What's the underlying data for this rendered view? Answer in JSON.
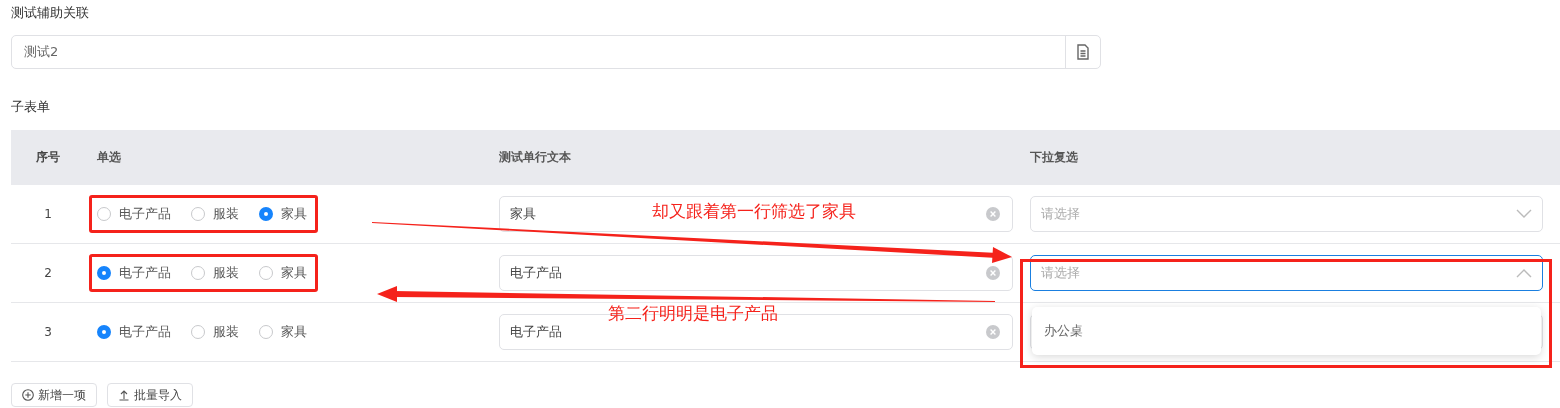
{
  "field": {
    "label": "测试辅助关联",
    "value": "测试2"
  },
  "subform": {
    "title": "子表单",
    "columns": [
      "序号",
      "单选",
      "测试单行文本",
      "下拉复选"
    ],
    "rows": [
      {
        "index": "1",
        "radio_highlighted": true,
        "options": [
          {
            "label": "电子产品",
            "selected": false
          },
          {
            "label": "服装",
            "selected": false
          },
          {
            "label": "家具",
            "selected": true
          }
        ],
        "text": "家具",
        "select": {
          "placeholder": "请选择",
          "expanded": false,
          "highlighted": false
        }
      },
      {
        "index": "2",
        "radio_highlighted": true,
        "options": [
          {
            "label": "电子产品",
            "selected": true
          },
          {
            "label": "服装",
            "selected": false
          },
          {
            "label": "家具",
            "selected": false
          }
        ],
        "text": "电子产品",
        "select": {
          "placeholder": "请选择",
          "expanded": true,
          "highlighted": true,
          "options": [
            "办公桌"
          ]
        }
      },
      {
        "index": "3",
        "radio_highlighted": false,
        "options": [
          {
            "label": "电子产品",
            "selected": true
          },
          {
            "label": "服装",
            "selected": false
          },
          {
            "label": "家具",
            "selected": false
          }
        ],
        "text": "电子产品",
        "select": {
          "expanded": false,
          "highlighted": false
        }
      }
    ],
    "buttons": [
      {
        "kind": "add",
        "label": "新增一项"
      },
      {
        "kind": "import",
        "label": "批量导入"
      }
    ]
  },
  "annotations": [
    {
      "kind": "upper",
      "text": "却又跟着第一行筛选了家具"
    },
    {
      "kind": "lower",
      "text": "第二行明明是电子产品"
    }
  ]
}
